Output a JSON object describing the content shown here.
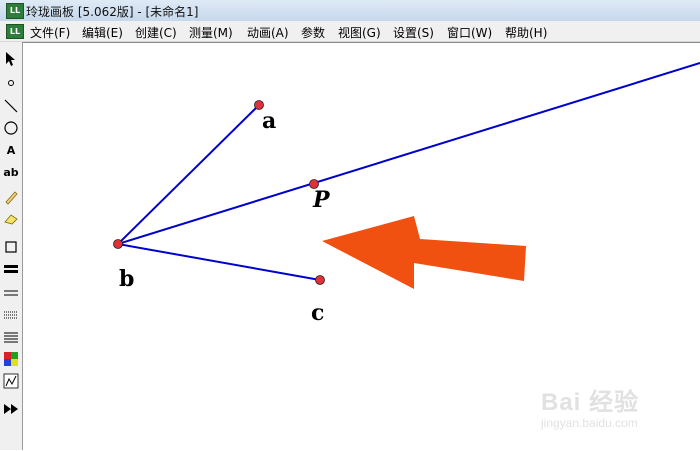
{
  "window": {
    "title": "玲珑画板 [5.062版] - [未命名1]",
    "app_icon_text": "LL"
  },
  "menu": {
    "items": [
      "文件(F)",
      "编辑(E)",
      "创建(C)",
      "测量(M)",
      "动画(A)",
      "参数",
      "视图(G)",
      "设置(S)",
      "窗口(W)",
      "帮助(H)"
    ]
  },
  "toolbox": {
    "tools": [
      {
        "name": "arrow-select-icon"
      },
      {
        "name": "point-tool-icon"
      },
      {
        "name": "segment-tool-icon"
      },
      {
        "name": "circle-tool-icon"
      },
      {
        "name": "text-tool-icon",
        "label": "A"
      },
      {
        "name": "label-tool-icon",
        "label": "ab"
      },
      {
        "name": "pencil-icon"
      },
      {
        "name": "eraser-icon"
      },
      {
        "name": "rectangle-icon"
      },
      {
        "name": "thick-line-icon"
      },
      {
        "name": "thin-line-icon"
      },
      {
        "name": "dotted-line-icon"
      },
      {
        "name": "line-weight-icon"
      },
      {
        "name": "color-palette-icon"
      },
      {
        "name": "graph-icon"
      },
      {
        "name": "fast-forward-icon"
      }
    ]
  },
  "canvas": {
    "point_labels": {
      "a": "a",
      "b": "b",
      "c": "c",
      "P": "P"
    },
    "colors": {
      "line": "#0000cc",
      "point": "#e0303a",
      "arrow": "#f05010"
    }
  },
  "watermark": {
    "text": "Bai 经验",
    "sub": "jingyan.baidu.com"
  }
}
